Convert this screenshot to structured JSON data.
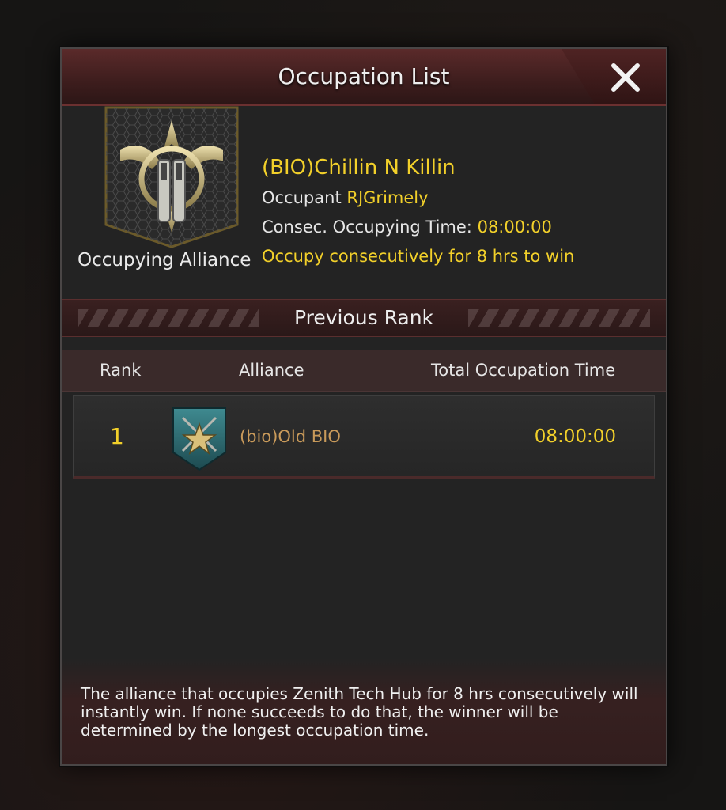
{
  "dialog": {
    "title": "Occupation List"
  },
  "occupying": {
    "emblem_label": "Occupying Alliance",
    "alliance_name": "(BIO)Chillin N Killin",
    "occupant_label": "Occupant",
    "occupant_name": "RJGrimely",
    "consec_label": "Consec. Occupying Time:",
    "consec_time": "08:00:00",
    "win_condition": "Occupy consecutively for 8 hrs to win"
  },
  "previous_rank": {
    "header": "Previous Rank",
    "columns": [
      "Rank",
      "Alliance",
      "Total Occupation Time"
    ],
    "rows": [
      {
        "rank": "1",
        "alliance": "(bio)Old BIO",
        "time": "08:00:00"
      }
    ]
  },
  "footer": {
    "note": "The alliance that occupies Zenith Tech Hub for 8 hrs consecutively will instantly win. If none succeeds to do that, the winner will be determined by the longest occupation time."
  },
  "colors": {
    "accent_yellow": "#f2d02a",
    "alliance_brown": "#c99a5a",
    "title_red": "#4a2222"
  },
  "icons": [
    "close-icon",
    "alliance-emblem-revolver-icon",
    "alliance-badge-star-icon"
  ]
}
